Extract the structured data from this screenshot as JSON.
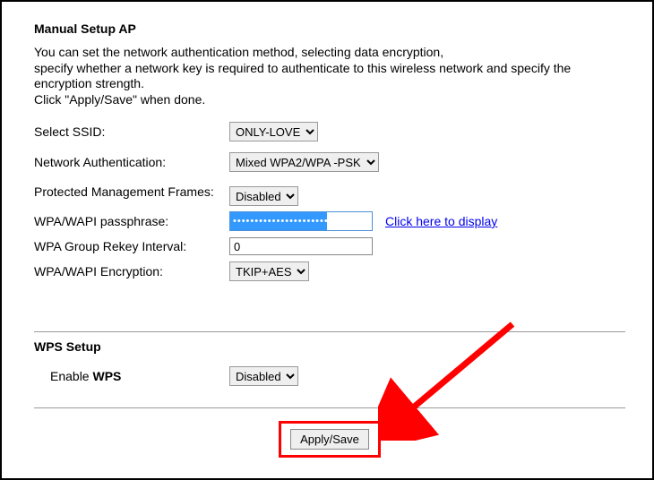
{
  "heading": "Manual Setup AP",
  "intro_lines": [
    "You can set the network authentication method, selecting data encryption,",
    "specify whether a network key is required to authenticate to this wireless network and specify the encryption strength.",
    "Click \"Apply/Save\" when done."
  ],
  "form": {
    "ssid": {
      "label": "Select SSID:",
      "value": "ONLY-LOVE"
    },
    "auth": {
      "label": "Network Authentication:",
      "value": "Mixed WPA2/WPA -PSK"
    },
    "pmf": {
      "label": "Protected Management Frames:",
      "value": "Disabled"
    },
    "passphrase": {
      "label": "WPA/WAPI passphrase:",
      "value": "••••••••••••••••••••••",
      "link": "Click here to display"
    },
    "rekey": {
      "label": "WPA Group Rekey Interval:",
      "value": "0"
    },
    "encryption": {
      "label": "WPA/WAPI Encryption:",
      "value": "TKIP+AES"
    }
  },
  "wps": {
    "heading": "WPS Setup",
    "enable_label_prefix": "Enable ",
    "enable_label_bold": "WPS",
    "value": "Disabled"
  },
  "button": {
    "apply": "Apply/Save"
  },
  "annotation": {
    "color": "#ff0000"
  }
}
